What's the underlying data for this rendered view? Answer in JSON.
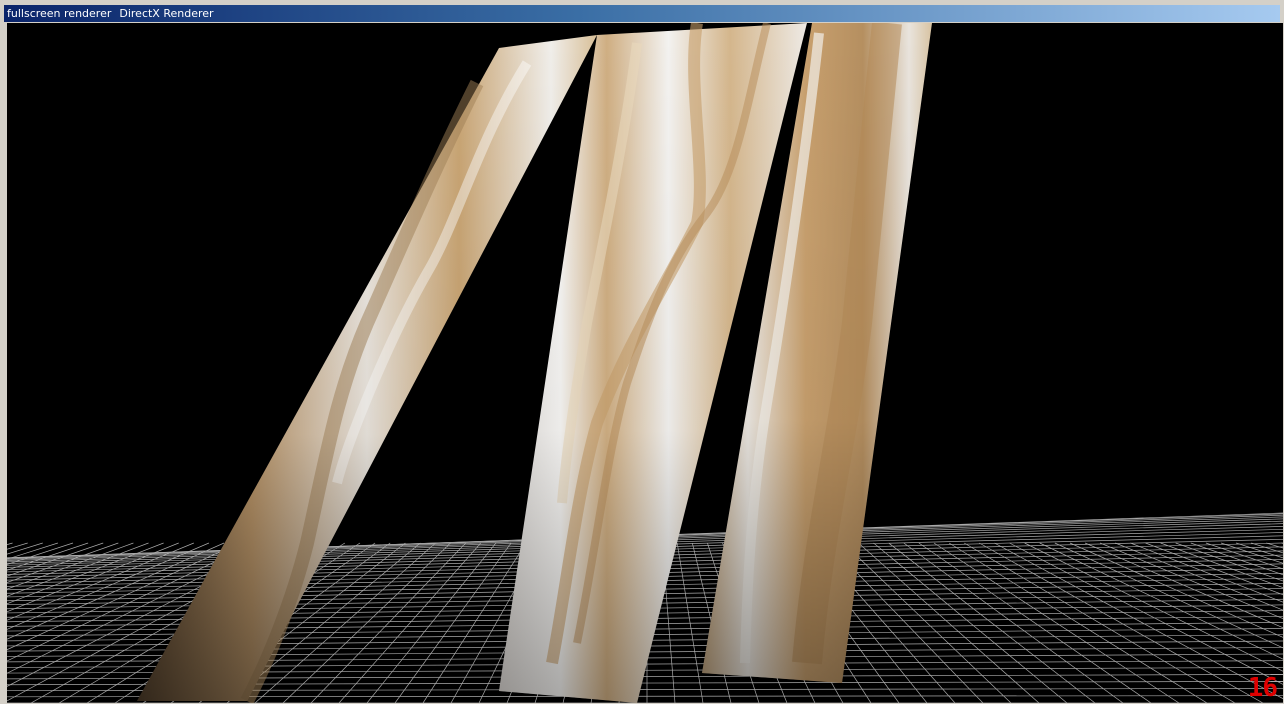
{
  "window": {
    "title": "fullscreen renderer",
    "subtitle": "DirectX Renderer"
  },
  "viewport": {
    "background": "#000000",
    "grid_color": "#c8c8c8",
    "texture_light": "#f2f1ee",
    "texture_tan": "#c9a574",
    "texture_dark": "#4a3a28"
  },
  "hud": {
    "fps": "16",
    "fps_color": "#e00000"
  }
}
